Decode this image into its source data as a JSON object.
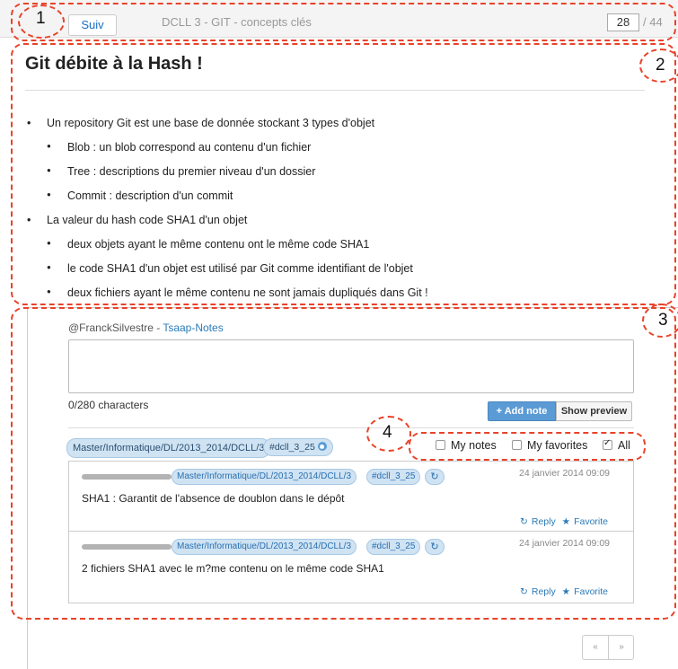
{
  "toolbar": {
    "next_label": "Suiv",
    "deck_title": "DCLL 3 - GIT - concepts clés",
    "page_current": "28",
    "page_total": "/ 44"
  },
  "callouts": [
    "1",
    "2",
    "3",
    "4"
  ],
  "slide": {
    "title": "Git débite à la Hash !",
    "items": [
      {
        "level": 1,
        "text": "Un repository Git est une base de donnée stockant 3 types d'objet"
      },
      {
        "level": 2,
        "text": "Blob : un blob correspond au contenu d'un fichier"
      },
      {
        "level": 2,
        "text": "Tree : descriptions du premier niveau d'un dossier"
      },
      {
        "level": 2,
        "text": "Commit : description d'un commit"
      },
      {
        "level": 1,
        "text": "La valeur du hash code SHA1 d'un objet"
      },
      {
        "level": 2,
        "text": "deux objets ayant le même contenu ont le même code SHA1"
      },
      {
        "level": 2,
        "text": "le code SHA1 d'un objet est utilisé par Git comme identifiant de l'objet"
      },
      {
        "level": 2,
        "text": "deux fichiers ayant le même contenu ne sont jamais dupliqués dans Git !"
      }
    ]
  },
  "notes": {
    "author_handle": "@FranckSilvestre",
    "author_sep": " - ",
    "author_app": "Tsaap-Notes",
    "textarea_value": "",
    "char_count": "0/280 characters",
    "add_label": "+ Add note",
    "preview_label": "Show preview",
    "context_tag": "Master/Informatique/DL/2013_2014/DCLL/3",
    "hash_tag": "#dcll_3_25",
    "filters": {
      "my_notes": {
        "label": "My notes",
        "checked": false
      },
      "my_favorites": {
        "label": "My favorites",
        "checked": false
      },
      "all": {
        "label": "All",
        "checked": true
      }
    },
    "items": [
      {
        "context": "Master/Informatique/DL/2013_2014/DCLL/3",
        "tag": "#dcll_3_25",
        "date": "24 janvier 2014 09:09",
        "text": "SHA1 : Garantit de l'absence de doublon dans le dépôt",
        "reply_label": "Reply",
        "favorite_label": "Favorite"
      },
      {
        "context": "Master/Informatique/DL/2013_2014/DCLL/3",
        "tag": "#dcll_3_25",
        "date": "24 janvier 2014 09:09",
        "text": "2 fichiers SHA1 avec le m?me contenu on le même code SHA1",
        "reply_label": "Reply",
        "favorite_label": "Favorite"
      }
    ]
  },
  "pager": {
    "prev": "«",
    "next": "»"
  },
  "colors": {
    "annotation": "#e8432a",
    "accent": "#5b9bd5",
    "link": "#2a7ab8",
    "tag_bg": "#cfe3f3"
  }
}
